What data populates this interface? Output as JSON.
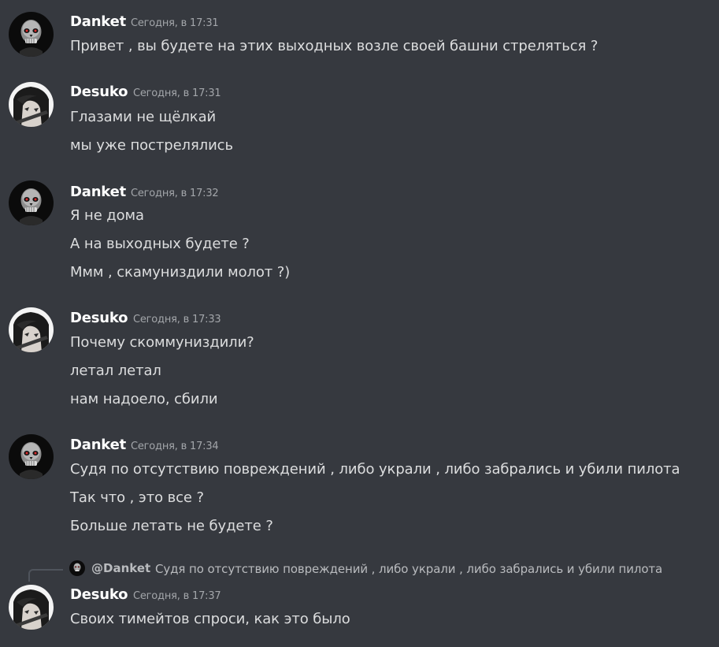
{
  "colors": {
    "background": "#36393f",
    "author": "#ffffff",
    "message_text": "#dcddde",
    "timestamp": "#a3a6aa",
    "reply_text": "#b9bbbe",
    "danket_eye_accent": "#d92b2b"
  },
  "avatars": {
    "danket": "skull-icon",
    "desuko": "anime-character-icon"
  },
  "messages": [
    {
      "author": "Danket",
      "timestamp": "Сегодня, в 17:31",
      "lines": [
        "Привет , вы будете на этих выходных возле своей башни стреляться ?"
      ]
    },
    {
      "author": "Desuko",
      "timestamp": "Сегодня, в 17:31",
      "lines": [
        "Глазами не щёлкай",
        "мы уже пострелялись"
      ]
    },
    {
      "author": "Danket",
      "timestamp": "Сегодня, в 17:32",
      "lines": [
        "Я не дома",
        "А на выходных будете ?",
        "Ммм , скамуниздили молот ?)"
      ]
    },
    {
      "author": "Desuko",
      "timestamp": "Сегодня, в 17:33",
      "lines": [
        "Почему скоммуниздили?",
        "летал летал",
        "нам надоело, сбили"
      ]
    },
    {
      "author": "Danket",
      "timestamp": "Сегодня, в 17:34",
      "lines": [
        "Судя по отсутствию повреждений , либо украли , либо забрались и убили пилота",
        "Так что , это все ?",
        "Больше летать не будете ?"
      ]
    },
    {
      "author": "Desuko",
      "timestamp": "Сегодня, в 17:37",
      "lines": [
        "Своих тимейтов спроси, как это было"
      ],
      "reply": {
        "mention": "@Danket",
        "text": "Судя по отсутствию повреждений , либо украли , либо забрались и убили пилота"
      }
    }
  ]
}
